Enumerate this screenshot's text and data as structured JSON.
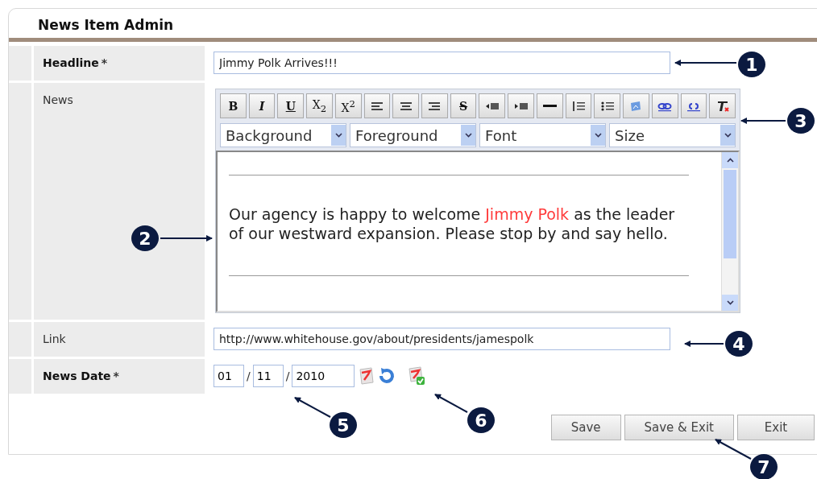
{
  "window": {
    "title": "News Item Admin"
  },
  "fields": [
    {
      "kind": "text",
      "label": "Headline",
      "required": true,
      "mark": "*",
      "value": "Jimmy Polk Arrives!!!"
    },
    {
      "kind": "editor",
      "label": "News",
      "required": false,
      "toolbar": [
        {
          "kind": "text",
          "label": "B"
        },
        {
          "kind": "text",
          "label": "I"
        },
        {
          "kind": "text",
          "label": "U"
        },
        {
          "kind": "text",
          "label": "X$_{2}$"
        },
        {
          "kind": "text",
          "label": "X$^{2}$"
        },
        {
          "kind": "icon"
        },
        {
          "kind": "icon"
        },
        {
          "kind": "icon"
        },
        {
          "kind": "text",
          "label": "S"
        },
        {
          "kind": "icon"
        },
        {
          "kind": "icon"
        },
        {
          "kind": "icon"
        },
        {
          "kind": "icon"
        },
        {
          "kind": "icon"
        },
        {
          "kind": "icon"
        },
        {
          "kind": "icon"
        },
        {
          "kind": "icon"
        },
        {
          "kind": "icon"
        }
      ],
      "dropdowns": [
        "Background",
        "Foreground",
        "Font",
        "Size"
      ],
      "body": [
        {
          "text": "Our agency is happy to welcome "
        },
        {
          "text": "Jimmy Polk",
          "color": "#ff3b3b"
        },
        {
          "text": " as the leader of our westward expansion. Please stop by and say hello."
        }
      ]
    },
    {
      "kind": "text",
      "label": "Link",
      "required": false,
      "value": "http://www.whitehouse.gov/about/presidents/jamespolk"
    },
    {
      "kind": "date",
      "label": "News Date",
      "required": true,
      "mark": "*",
      "parts": [
        "01",
        "11",
        "2010"
      ],
      "separator": "/"
    }
  ],
  "buttons": [
    "Save",
    "Save & Exit",
    "Exit"
  ],
  "callouts": [
    "1",
    "2",
    "3",
    "4",
    "5",
    "6",
    "7"
  ]
}
